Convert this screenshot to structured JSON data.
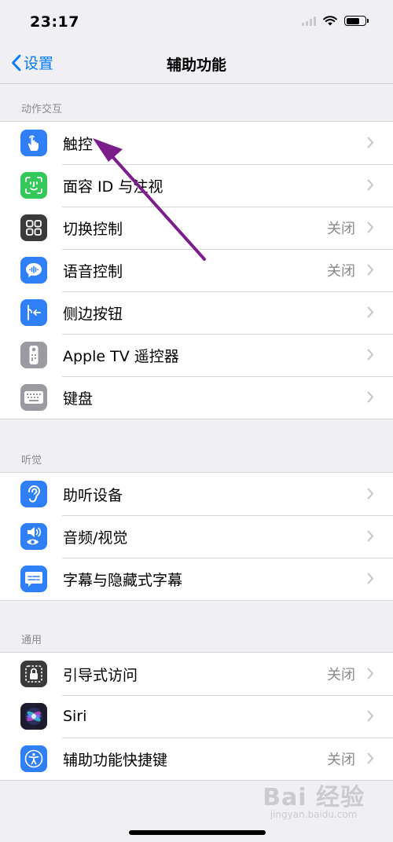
{
  "status_bar": {
    "time": "23:17"
  },
  "nav": {
    "back_label": "设置",
    "title": "辅助功能"
  },
  "sections": [
    {
      "header": "动作交互",
      "items": [
        {
          "label": "触控",
          "value": "",
          "icon": "touch-hand-icon",
          "color": "#2f7ff6"
        },
        {
          "label": "面容 ID 与注视",
          "value": "",
          "icon": "face-id-icon",
          "color": "#34c759"
        },
        {
          "label": "切换控制",
          "value": "关闭",
          "icon": "switch-control-icon",
          "color": "#3a3a3c"
        },
        {
          "label": "语音控制",
          "value": "关闭",
          "icon": "voice-control-icon",
          "color": "#2f7ff6"
        },
        {
          "label": "侧边按钮",
          "value": "",
          "icon": "side-button-icon",
          "color": "#2f7ff6"
        },
        {
          "label": "Apple TV 遥控器",
          "value": "",
          "icon": "tv-remote-icon",
          "color": "#9a9aa0"
        },
        {
          "label": "键盘",
          "value": "",
          "icon": "keyboard-icon",
          "color": "#9a9aa0"
        }
      ]
    },
    {
      "header": "听觉",
      "items": [
        {
          "label": "助听设备",
          "value": "",
          "icon": "ear-icon",
          "color": "#2f7ff6"
        },
        {
          "label": "音频/视觉",
          "value": "",
          "icon": "audio-visual-icon",
          "color": "#2f7ff6"
        },
        {
          "label": "字幕与隐藏式字幕",
          "value": "",
          "icon": "subtitles-icon",
          "color": "#2f7ff6"
        }
      ]
    },
    {
      "header": "通用",
      "items": [
        {
          "label": "引导式访问",
          "value": "关闭",
          "icon": "guided-access-lock-icon",
          "color": "#3a3a3c"
        },
        {
          "label": "Siri",
          "value": "",
          "icon": "siri-icon",
          "color": "#1c1c2e"
        },
        {
          "label": "辅助功能快捷键",
          "value": "关闭",
          "icon": "accessibility-icon",
          "color": "#2f7ff6"
        }
      ]
    }
  ],
  "watermark": {
    "main": "Bai 经验",
    "sub": "jingyan.baidu.com"
  }
}
